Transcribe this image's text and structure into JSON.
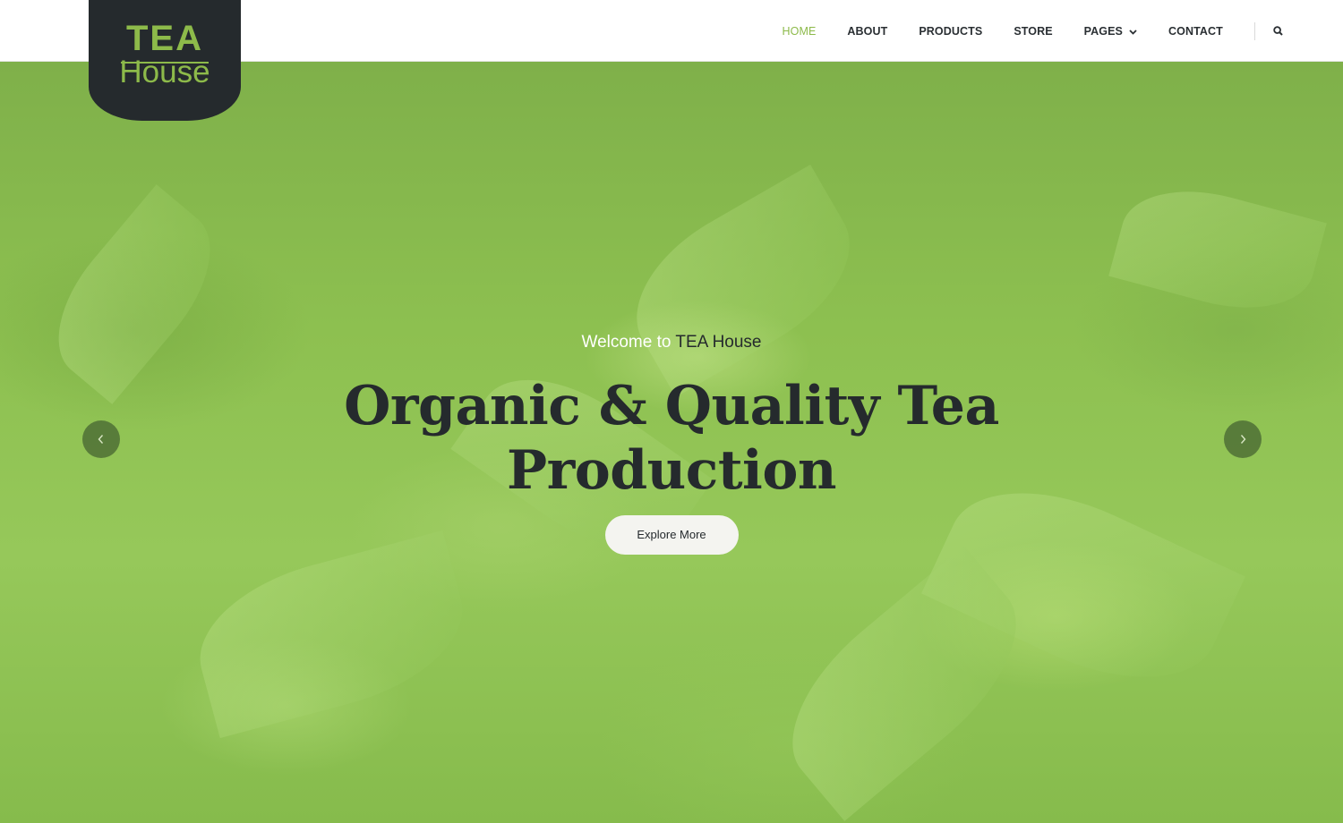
{
  "brand": {
    "logo_top": "TEA",
    "logo_bottom": "House"
  },
  "nav": {
    "items": [
      {
        "label": "HOME",
        "active": true
      },
      {
        "label": "ABOUT"
      },
      {
        "label": "PRODUCTS"
      },
      {
        "label": "STORE"
      },
      {
        "label": "PAGES",
        "has_dropdown": true
      },
      {
        "label": "CONTACT"
      }
    ],
    "search_icon": "search-icon"
  },
  "hero": {
    "welcome_prefix": "Welcome to",
    "welcome_brand": "TEA House",
    "headline_line1": "Organic & Quality Tea",
    "headline_line2": "Production",
    "cta_label": "Explore More",
    "prev_icon": "chevron-left-icon",
    "next_icon": "chevron-right-icon"
  },
  "colors": {
    "accent": "#8dba4a",
    "dark": "#252a2d",
    "header_bg": "#ffffff"
  }
}
